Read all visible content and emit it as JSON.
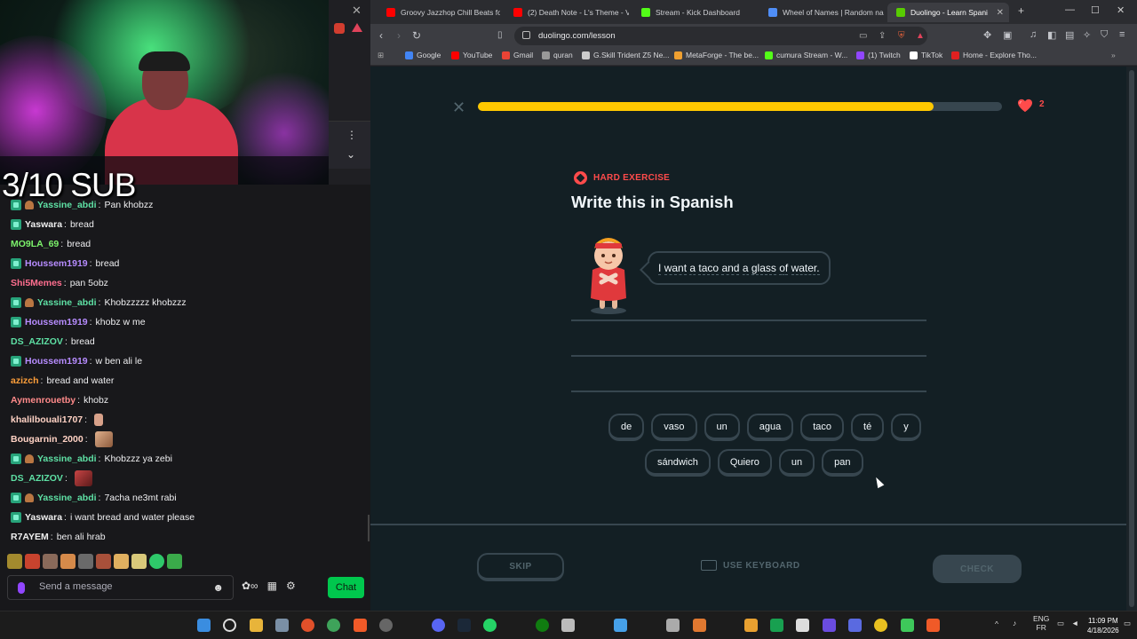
{
  "stream": {
    "overlay_text": "3/10 SUB",
    "chat": [
      {
        "user": "Yassine_abdi",
        "color": "#5ee0a4",
        "badges": [
          "sub",
          "sword"
        ],
        "msg": "Pan khobzz"
      },
      {
        "user": "Yaswara",
        "color": "#f0f0f0",
        "badges": [
          "sub"
        ],
        "msg": "bread"
      },
      {
        "user": "MO9LA_69",
        "color": "#7cf26b",
        "badges": [],
        "msg": "bread"
      },
      {
        "user": "Houssem1919",
        "color": "#b78cff",
        "badges": [
          "sub"
        ],
        "msg": "bread"
      },
      {
        "user": "Shi5Memes",
        "color": "#ff6e8f",
        "badges": [],
        "msg": "pan 5obz"
      },
      {
        "user": "Yassine_abdi",
        "color": "#5ee0a4",
        "badges": [
          "sub",
          "sword"
        ],
        "msg": "Khobzzzzz khobzzz"
      },
      {
        "user": "Houssem1919",
        "color": "#b78cff",
        "badges": [
          "sub"
        ],
        "msg": "khobz w me"
      },
      {
        "user": "DS_AZIZOV",
        "color": "#5ee0a4",
        "badges": [],
        "msg": "bread"
      },
      {
        "user": "Houssem1919",
        "color": "#b78cff",
        "badges": [
          "sub"
        ],
        "msg": "w ben ali le"
      },
      {
        "user": "azizch",
        "color": "#ff9f3a",
        "badges": [],
        "msg": "bread and water"
      },
      {
        "user": "Aymenrouetby",
        "color": "#ff8a8a",
        "badges": [],
        "msg": "khobz"
      },
      {
        "user": "khalilbouali1707",
        "color": "#ffd2c4",
        "badges": [],
        "msg": "",
        "emote": "mini"
      },
      {
        "user": "Bougarnin_2000",
        "color": "#ffd2c4",
        "badges": [],
        "msg": "",
        "emote": "face"
      },
      {
        "user": "Yassine_abdi",
        "color": "#5ee0a4",
        "badges": [
          "sub",
          "sword"
        ],
        "msg": "Khobzzz ya zebi"
      },
      {
        "user": "DS_AZIZOV",
        "color": "#5ee0a4",
        "badges": [],
        "msg": "",
        "emote": "red"
      },
      {
        "user": "Yassine_abdi",
        "color": "#5ee0a4",
        "badges": [
          "sub",
          "sword"
        ],
        "msg": "7acha ne3mt rabi"
      },
      {
        "user": "Yaswara",
        "color": "#f0f0f0",
        "badges": [
          "sub"
        ],
        "msg": "i want bread and water please"
      },
      {
        "user": "R7AYEM",
        "color": "#f0f0f0",
        "badges": [],
        "msg": "ben ali hrab"
      }
    ],
    "chat_input_placeholder": "Send a message",
    "chat_button": "Chat"
  },
  "browser": {
    "tabs": [
      {
        "label": "Groovy Jazzhop Chill Beats for",
        "fav": "#ff0000"
      },
      {
        "label": "(2) Death Note - L's Theme - Vi",
        "fav": "#ff0000"
      },
      {
        "label": "Stream - Kick Dashboard",
        "fav": "#53fc18"
      },
      {
        "label": "Wheel of Names | Random nam",
        "fav": "#4f8ef7"
      },
      {
        "label": "Duolingo - Learn Spani",
        "fav": "#58cc02"
      }
    ],
    "url": "duolingo.com/lesson",
    "bookmarks": [
      {
        "label": "Google",
        "fav": "#4285f4"
      },
      {
        "label": "YouTube",
        "fav": "#ff0000"
      },
      {
        "label": "Gmail",
        "fav": "#ea4335"
      },
      {
        "label": "quran",
        "fav": "#999999"
      },
      {
        "label": "G.Skill Trident Z5 Ne...",
        "fav": "#cccccc"
      },
      {
        "label": "MetaForge - The be...",
        "fav": "#f0a030"
      },
      {
        "label": "cumura Stream - W...",
        "fav": "#53fc18"
      },
      {
        "label": "(1) Twitch",
        "fav": "#9146ff"
      },
      {
        "label": "TikTok",
        "fav": "#ffffff"
      },
      {
        "label": "Home - Explore Tho...",
        "fav": "#e02020"
      }
    ]
  },
  "lesson": {
    "progress": 0.87,
    "hearts": "2",
    "badge": "HARD EXERCISE",
    "title": "Write this in Spanish",
    "prompt_words": [
      "I",
      "want",
      "a",
      "taco",
      "and",
      "a",
      "glass",
      "of",
      "water."
    ],
    "word_bank_row1": [
      "de",
      "vaso",
      "un",
      "agua",
      "taco",
      "té",
      "y"
    ],
    "word_bank_row2": [
      "sándwich",
      "Quiero",
      "un",
      "pan"
    ],
    "skip": "SKIP",
    "use_keyboard": "USE KEYBOARD",
    "check": "CHECK"
  },
  "taskbar": {
    "lang_top": "ENG",
    "lang_bottom": "FR",
    "time": "11:09 PM",
    "date": "4/18/2026"
  },
  "colors": {
    "progress_fill": "#ffc800",
    "heart": "#ff4b4b",
    "hard_badge": "#ff4b4b"
  }
}
